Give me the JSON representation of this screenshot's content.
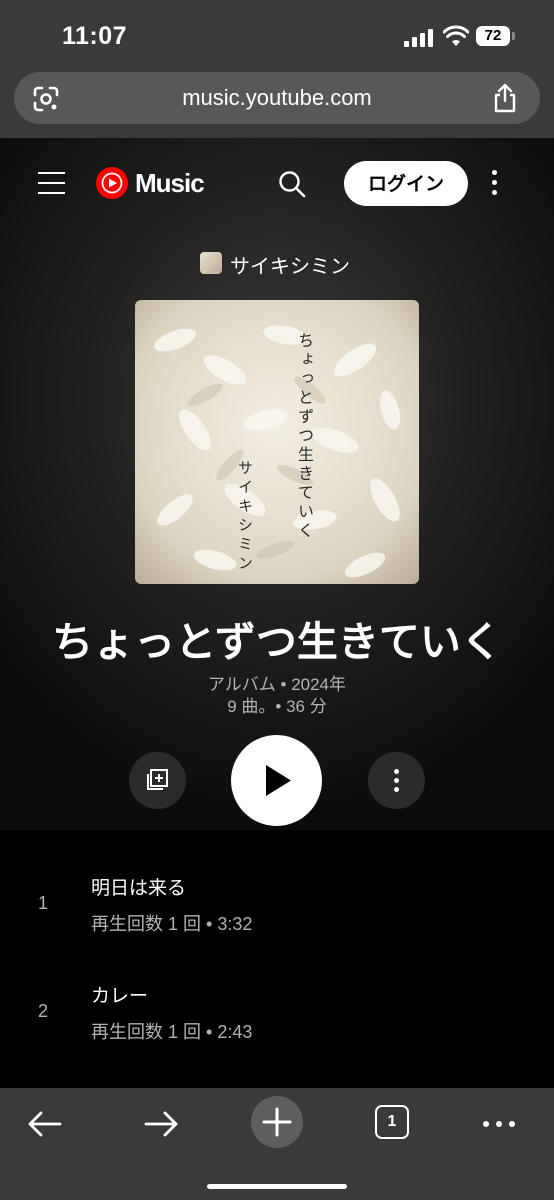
{
  "status_bar": {
    "time": "11:07",
    "battery": "72"
  },
  "browser": {
    "url": "music.youtube.com"
  },
  "header": {
    "brand": "Music",
    "login_label": "ログイン"
  },
  "album": {
    "artist": "サイキシミン",
    "title": "ちょっとずつ生きていく",
    "type_year": "アルバム • 2024年",
    "tracks_duration": "9 曲。• 36 分",
    "cover_title": "ちょっとずつ生きていく",
    "cover_artist": "サイキシミン"
  },
  "tracks": [
    {
      "number": "1",
      "title": "明日は来る",
      "sub": "再生回数 1 回 • 3:32"
    },
    {
      "number": "2",
      "title": "カレー",
      "sub": "再生回数 1 回 • 2:43"
    }
  ],
  "toolbar": {
    "tab_count": "1"
  },
  "colors": {
    "brand_red": "#ff0000",
    "toolbar_bg": "#3a3a3c",
    "secondary_text": "#b3b3b3"
  }
}
